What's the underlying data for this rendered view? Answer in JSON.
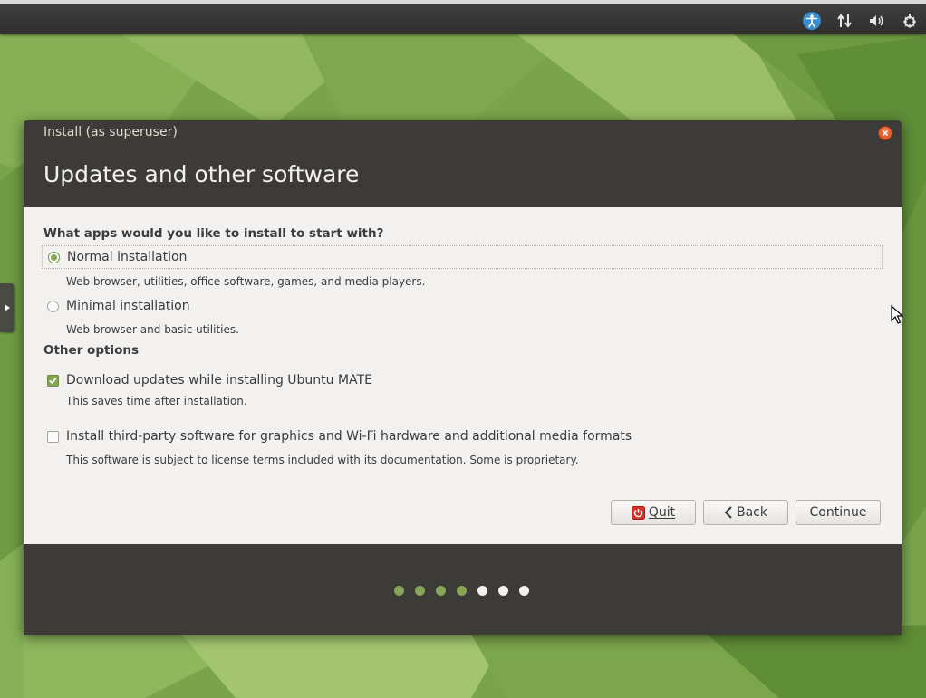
{
  "colors": {
    "panel": "#2f2f2f",
    "window_header": "#3c3b37",
    "accent_green": "#87a556",
    "close_button": "#e5592e",
    "accessibility_blue": "#3a8ed0"
  },
  "top_panel": {
    "tray_icons": [
      "accessibility-icon",
      "network-icon",
      "volume-icon",
      "settings-icon"
    ]
  },
  "window": {
    "title": "Install (as superuser)",
    "heading": "Updates and other software",
    "question": "What apps would you like to install to start with?",
    "options": [
      {
        "label": "Normal installation",
        "description": "Web browser, utilities, office software, games, and media players.",
        "selected": true
      },
      {
        "label": "Minimal installation",
        "description": "Web browser and basic utilities.",
        "selected": false
      }
    ],
    "other_options_label": "Other options",
    "checkboxes": [
      {
        "label": "Download updates while installing Ubuntu MATE",
        "description": "This saves time after installation.",
        "checked": true
      },
      {
        "label": "Install third-party software for graphics and Wi-Fi hardware and additional media formats",
        "description": "This software is subject to license terms included with its documentation. Some is proprietary.",
        "checked": false
      }
    ],
    "buttons": {
      "quit": "Quit",
      "back": "Back",
      "continue": "Continue"
    },
    "progress": {
      "total_steps": 7,
      "completed_steps": 4
    }
  }
}
